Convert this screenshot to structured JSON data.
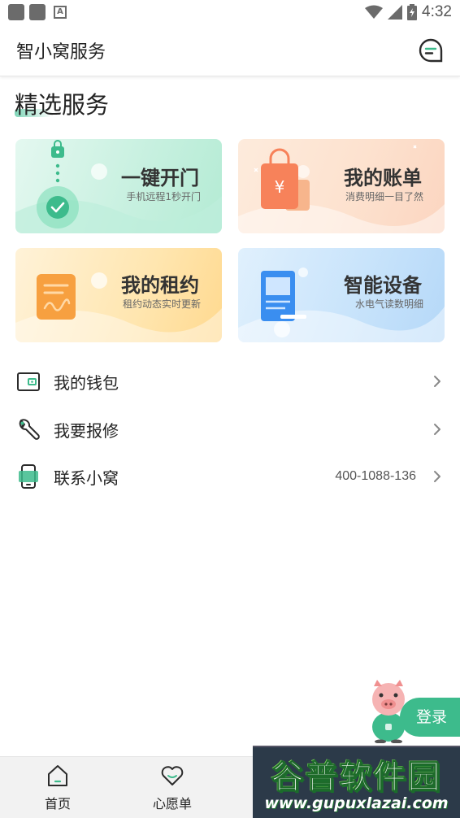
{
  "status_bar": {
    "time": "4:32",
    "notification_icons": [
      "square-icon",
      "square-icon",
      "font-a-icon"
    ],
    "system_icons": [
      "wifi-icon",
      "signal-icon",
      "battery-icon"
    ]
  },
  "app_bar": {
    "title": "智小窝服务",
    "action_icon": "chat-bubble-icon"
  },
  "section": {
    "title": "精选服务",
    "accent_color": "#7fd6b8"
  },
  "cards": [
    {
      "id": "door",
      "title": "一键开门",
      "subtitle": "手机远程1秒开门",
      "icon": "lock-unlock-icon"
    },
    {
      "id": "bill",
      "title": "我的账单",
      "subtitle": "消费明细一目了然",
      "icon": "yuan-bag-icon"
    },
    {
      "id": "lease",
      "title": "我的租约",
      "subtitle": "租约动态实时更新",
      "icon": "contract-icon"
    },
    {
      "id": "device",
      "title": "智能设备",
      "subtitle": "水电气读数明细",
      "icon": "meter-icon"
    }
  ],
  "list": [
    {
      "label": "我的钱包",
      "value": "",
      "icon": "wallet-icon"
    },
    {
      "label": "我要报修",
      "value": "",
      "icon": "wrench-icon"
    },
    {
      "label": "联系小窝",
      "value": "400-1088-136",
      "icon": "phone-icon"
    }
  ],
  "login": {
    "label": "登录",
    "color": "#3dbb8c"
  },
  "bottom_nav": [
    {
      "label": "首页",
      "icon": "home-icon"
    },
    {
      "label": "心愿单",
      "icon": "heart-icon"
    }
  ],
  "watermark": {
    "title": "谷普软件园",
    "url": "www.gupuxlazai.com"
  }
}
